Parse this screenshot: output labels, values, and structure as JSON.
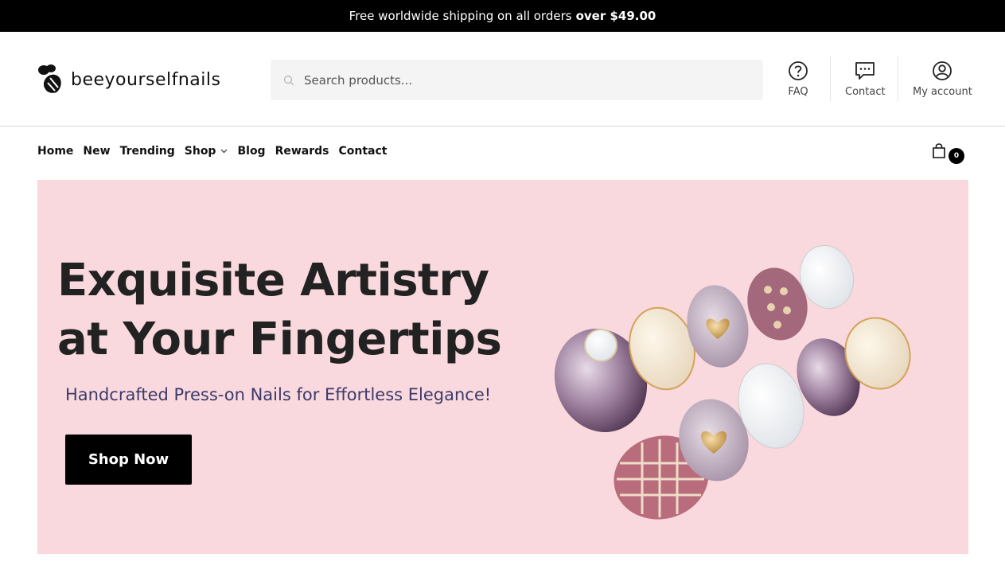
{
  "announcement": {
    "text": "Free worldwide shipping on all orders",
    "emphasis": "over $49.00"
  },
  "brand": {
    "logo_text": "beeyourselfnails",
    "logo_icon": "bee-icon"
  },
  "search": {
    "placeholder": "Search products...",
    "value": ""
  },
  "header_links": {
    "faq": "FAQ",
    "contact": "Contact",
    "account": "My account"
  },
  "nav": {
    "items": [
      {
        "label": "Home"
      },
      {
        "label": "New"
      },
      {
        "label": "Trending"
      },
      {
        "label": "Shop",
        "has_dropdown": true
      },
      {
        "label": "Blog"
      },
      {
        "label": "Rewards"
      },
      {
        "label": "Contact"
      }
    ]
  },
  "cart": {
    "count": "0"
  },
  "hero": {
    "title": "Exquisite Artistry at Your Fingertips",
    "subtitle": "Handcrafted Press-on Nails for Effortless Elegance!",
    "cta": "Shop Now",
    "background": "#f9d9dd"
  },
  "colors": {
    "topbar": "#000000",
    "accent": "#000000",
    "subtitle": "#3c3a6a"
  }
}
